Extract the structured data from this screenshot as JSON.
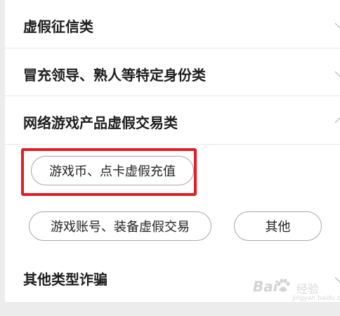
{
  "categories": [
    {
      "label": "虚假征信类",
      "expanded": false
    },
    {
      "label": "冒充领导、熟人等特定身份类",
      "expanded": false
    },
    {
      "label": "网络游戏产品虚假交易类",
      "expanded": true
    },
    {
      "label": "其他类型诈骗",
      "expanded": false
    }
  ],
  "options": [
    {
      "label": "游戏币、点卡虚假充值",
      "highlighted": true
    },
    {
      "label": "游戏账号、装备虚假交易",
      "highlighted": false
    },
    {
      "label": "其他",
      "highlighted": false
    }
  ],
  "icons": {
    "collapsed": "chevron-down-icon",
    "expanded": "chevron-up-icon"
  },
  "colors": {
    "highlight_border": "#e31b23",
    "chip_border": "#a8a8a8",
    "text": "#1e1e1e",
    "background": "#ececec"
  },
  "watermark": {
    "brand_left": "Bai",
    "brand_right": "经验",
    "url": "jingyan.baidu.com"
  }
}
